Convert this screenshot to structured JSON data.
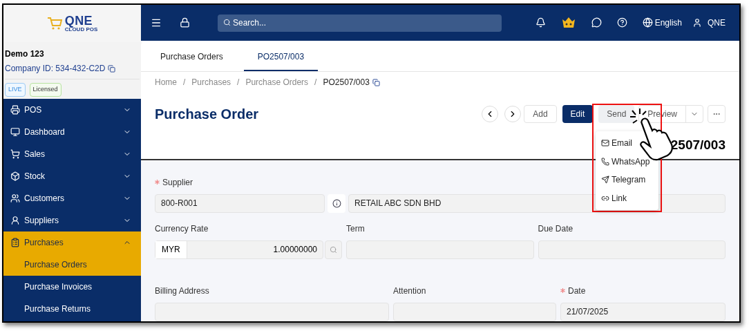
{
  "logo": {
    "title": "QNE",
    "subtitle": "CLOUD POS"
  },
  "company": {
    "name": "Demo 123",
    "id_label": "Company ID: 534-432-C2D",
    "badges": [
      {
        "label": "LIVE",
        "kind": "live"
      },
      {
        "label": "Licensed",
        "kind": "licensed"
      }
    ]
  },
  "sidebar": {
    "items": [
      {
        "label": "POS",
        "expanded": false,
        "selected": false
      },
      {
        "label": "Dashboard",
        "expanded": false,
        "selected": false
      },
      {
        "label": "Sales",
        "expanded": false,
        "selected": false
      },
      {
        "label": "Stock",
        "expanded": false,
        "selected": false
      },
      {
        "label": "Customers",
        "expanded": false,
        "selected": false
      },
      {
        "label": "Suppliers",
        "expanded": false,
        "selected": false
      },
      {
        "label": "Purchases",
        "expanded": true,
        "selected": true,
        "children": [
          {
            "label": "Purchase Orders",
            "selected": true
          },
          {
            "label": "Purchase Invoices",
            "selected": false
          },
          {
            "label": "Purchase Returns",
            "selected": false
          }
        ]
      }
    ]
  },
  "header": {
    "search_placeholder": "Search...",
    "language": "English",
    "user": "QNE"
  },
  "tabs": [
    {
      "label": "Purchase Orders",
      "selected": false
    },
    {
      "label": "PO2507/003",
      "selected": true
    }
  ],
  "breadcrumb": {
    "separator": "/",
    "items": [
      "Home",
      "Purchases",
      "Purchase Orders",
      "PO2507/003"
    ]
  },
  "page_title": "Purchase Order",
  "toolbar": {
    "buttons": [
      {
        "label": "Add",
        "kind": "plain"
      },
      {
        "label": "Edit",
        "kind": "primary"
      },
      {
        "label": "Send",
        "kind": "active"
      },
      {
        "label": "Preview",
        "kind": "split"
      }
    ]
  },
  "send_menu": {
    "open": true,
    "items": [
      "Email",
      "WhatsApp",
      "Telegram",
      "Link"
    ]
  },
  "document_number": "2507/003",
  "form": {
    "supplier": {
      "label": "Supplier",
      "required": true,
      "code": "800-R001",
      "name": "RETAIL ABC SDN BHD"
    },
    "currency_rate": {
      "label": "Currency Rate",
      "currency": "MYR",
      "value": "1.00000000"
    },
    "term": {
      "label": "Term"
    },
    "due_date": {
      "label": "Due Date"
    },
    "billing_address": {
      "label": "Billing Address"
    },
    "attention": {
      "label": "Attention"
    },
    "date": {
      "label": "Date",
      "required": true,
      "value": "21/07/2025"
    }
  }
}
